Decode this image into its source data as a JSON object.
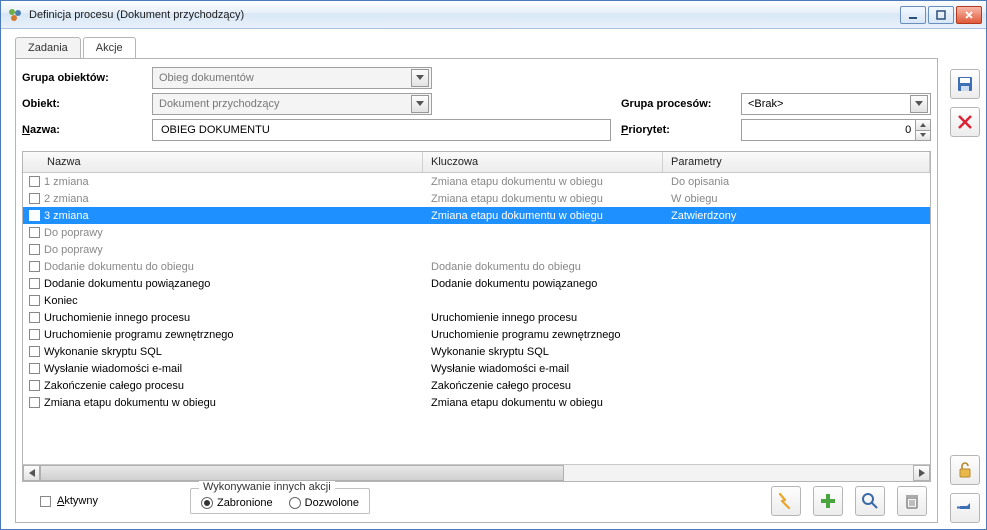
{
  "window": {
    "title": "Definicja procesu (Dokument przychodzący)"
  },
  "tabs": {
    "zadania_label": "Zadania",
    "akcje_label": "Akcje"
  },
  "form": {
    "grupa_obiektow_label": "Grupa obiektów:",
    "grupa_obiektow_value": "Obieg dokumentów",
    "obiekt_label": "Obiekt:",
    "obiekt_value": "Dokument przychodzący",
    "nazwa_label": "Nazwa:",
    "nazwa_value": "OBIEG DOKUMENTU",
    "grupa_procesow_label": "Grupa procesów:",
    "grupa_procesow_value": "<Brak>",
    "priorytet_label": "Priorytet:",
    "priorytet_value": "0"
  },
  "grid": {
    "col_nazwa": "Nazwa",
    "col_kluczowa": "Kluczowa",
    "col_parametry": "Parametry",
    "rows": [
      {
        "n": "1 zmiana",
        "k": "Zmiana etapu dokumentu w obiegu",
        "p": "Do opisania",
        "dim": true
      },
      {
        "n": "2 zmiana",
        "k": "Zmiana etapu dokumentu w obiegu",
        "p": "W obiegu",
        "dim": true
      },
      {
        "n": "3 zmiana",
        "k": "Zmiana etapu dokumentu w obiegu",
        "p": "Zatwierdzony",
        "sel": true
      },
      {
        "n": "Do poprawy",
        "k": "",
        "p": "",
        "dim": true
      },
      {
        "n": "Do poprawy",
        "k": "",
        "p": "",
        "dim": true
      },
      {
        "n": "Dodanie dokumentu do obiegu",
        "k": "Dodanie dokumentu do obiegu",
        "p": "",
        "dim": true
      },
      {
        "n": "Dodanie dokumentu powiązanego",
        "k": "Dodanie dokumentu powiązanego",
        "p": ""
      },
      {
        "n": "Koniec",
        "k": "",
        "p": ""
      },
      {
        "n": "Uruchomienie innego procesu",
        "k": "Uruchomienie innego procesu",
        "p": ""
      },
      {
        "n": "Uruchomienie programu zewnętrznego",
        "k": "Uruchomienie programu zewnętrznego",
        "p": ""
      },
      {
        "n": "Wykonanie skryptu SQL",
        "k": "Wykonanie skryptu SQL",
        "p": ""
      },
      {
        "n": "Wysłanie wiadomości e-mail",
        "k": "Wysłanie wiadomości e-mail",
        "p": ""
      },
      {
        "n": "Zakończenie całego procesu",
        "k": "Zakończenie całego procesu",
        "p": ""
      },
      {
        "n": "Zmiana etapu dokumentu w obiegu",
        "k": "Zmiana etapu dokumentu w obiegu",
        "p": ""
      }
    ]
  },
  "footer": {
    "aktywny_label": "Aktywny",
    "group_legend": "Wykonywanie innych akcji",
    "radio_zabronione": "Zabronione",
    "radio_dozwolone": "Dozwolone"
  }
}
